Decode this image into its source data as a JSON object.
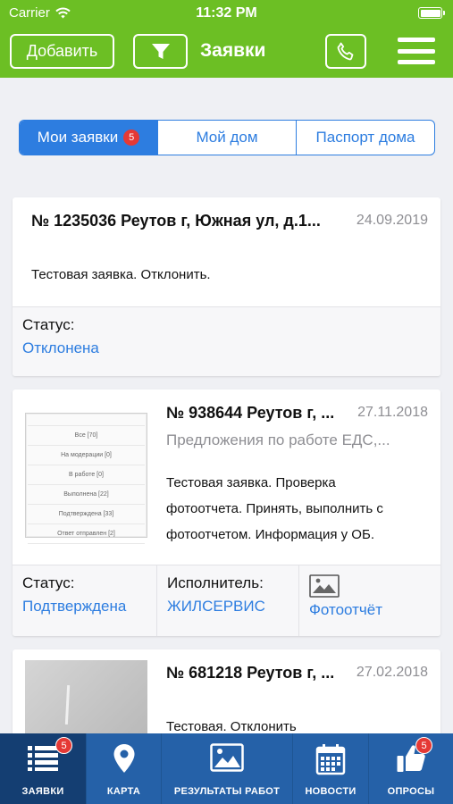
{
  "status_bar": {
    "carrier": "Carrier",
    "time": "11:32 PM"
  },
  "header": {
    "add_label": "Добавить",
    "title": "Заявки"
  },
  "segments": [
    {
      "label": "Мои заявки",
      "badge": "5"
    },
    {
      "label": "Мой дом"
    },
    {
      "label": "Паспорт дома"
    }
  ],
  "requests": [
    {
      "title": "№ 1235036 Реутов г, Южная ул, д.1...",
      "date": "24.09.2019",
      "description": "Тестовая заявка. Отклонить.",
      "status_label": "Статус:",
      "status_value": "Отклонена"
    },
    {
      "title": "№ 938644 Реутов г, ...",
      "date": "27.11.2018",
      "category": "Предложения по работе ЕДС,...",
      "description_lines": [
        "Тестовая заявка. Проверка",
        "фотоотчета. Принять, выполнить с",
        "фотоотчетом. Информация у ОБ."
      ],
      "status_label": "Статус:",
      "status_value": "Подтверждена",
      "executor_label": "Исполнитель:",
      "executor_value": "ЖИЛСЕРВИС",
      "photo_label": "Фотоотчёт",
      "thumb_items": [
        "Все [70]",
        "На модерации [0]",
        "В работе [0]",
        "Выполнена [22]",
        "Подтверждена [33]",
        "Ответ отправлен [2]"
      ]
    },
    {
      "title": "№ 681218 Реутов г, ...",
      "date": "27.02.2018",
      "description": "Тестовая. Отклонить"
    }
  ],
  "tabbar": [
    {
      "label": "ЗАЯВКИ",
      "icon": "list-icon",
      "badge": "5",
      "active": true
    },
    {
      "label": "КАРТА",
      "icon": "map-pin-icon"
    },
    {
      "label": "РЕЗУЛЬТАТЫ РАБОТ",
      "icon": "image-icon"
    },
    {
      "label": "НОВОСТИ",
      "icon": "calendar-icon"
    },
    {
      "label": "ОПРОСЫ",
      "icon": "thumbs-up-icon",
      "badge": "5"
    }
  ],
  "colors": {
    "header": "#6cbf24",
    "accent": "#2d7de0",
    "tabbar": "#2561a8",
    "tab_active": "#143e72",
    "badge": "#e53935"
  }
}
